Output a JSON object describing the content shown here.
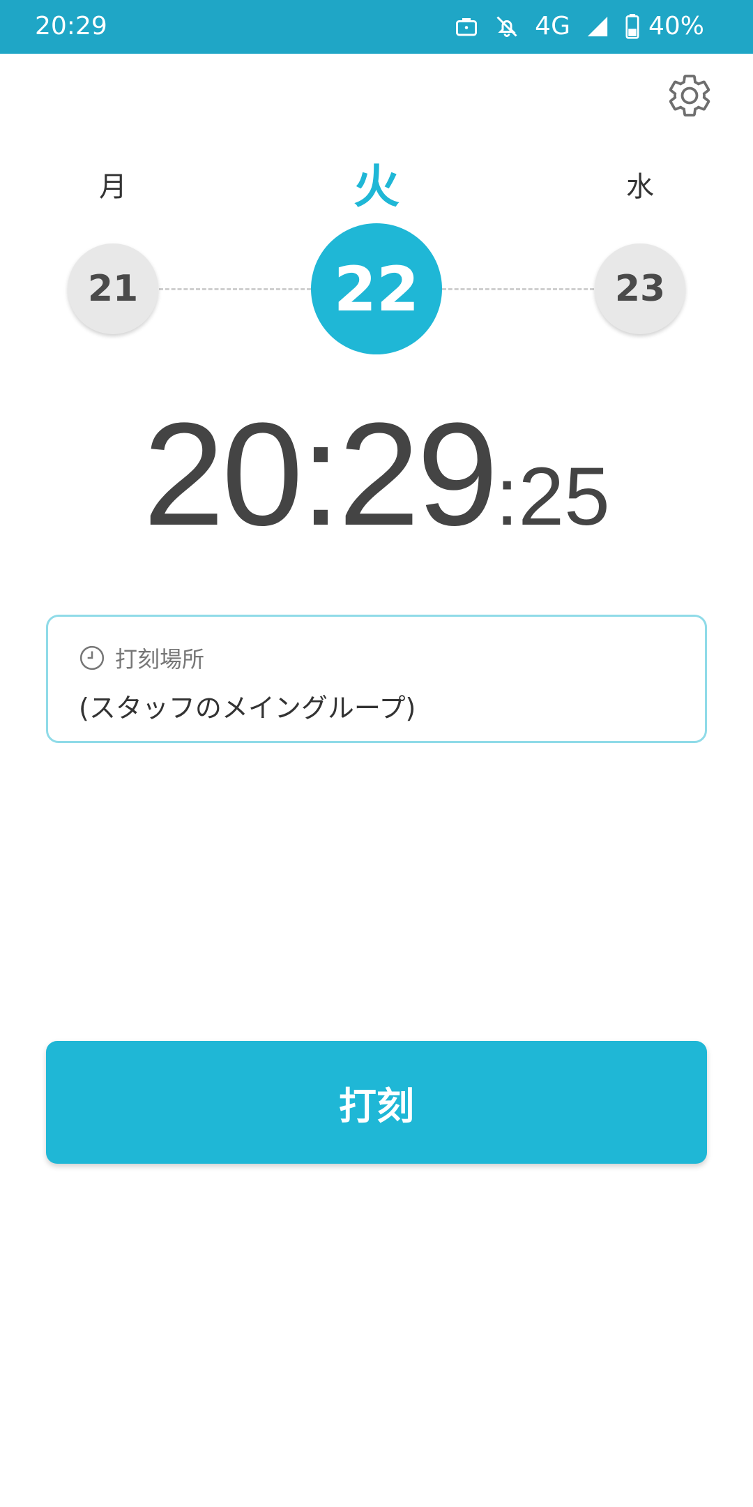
{
  "status_bar": {
    "time": "20:29",
    "network": "4G",
    "battery": "40%",
    "icons": [
      "briefcase-icon",
      "bell-off-icon",
      "signal-icon",
      "battery-icon"
    ]
  },
  "settings": {
    "icon": "gear-icon"
  },
  "days": {
    "prev": {
      "weekday": "月",
      "date": "21"
    },
    "current": {
      "weekday": "火",
      "date": "22"
    },
    "next": {
      "weekday": "水",
      "date": "23"
    }
  },
  "clock": {
    "hours_minutes": "20:29",
    "seconds": ":25"
  },
  "location": {
    "label": "打刻場所",
    "value": "(スタッフのメイングループ)"
  },
  "punch_button": {
    "label": "打刻"
  },
  "colors": {
    "status_bar": "#1fa6c6",
    "accent": "#1fb7d6",
    "card_border": "#8fdbe8",
    "text_dark": "#444444"
  }
}
